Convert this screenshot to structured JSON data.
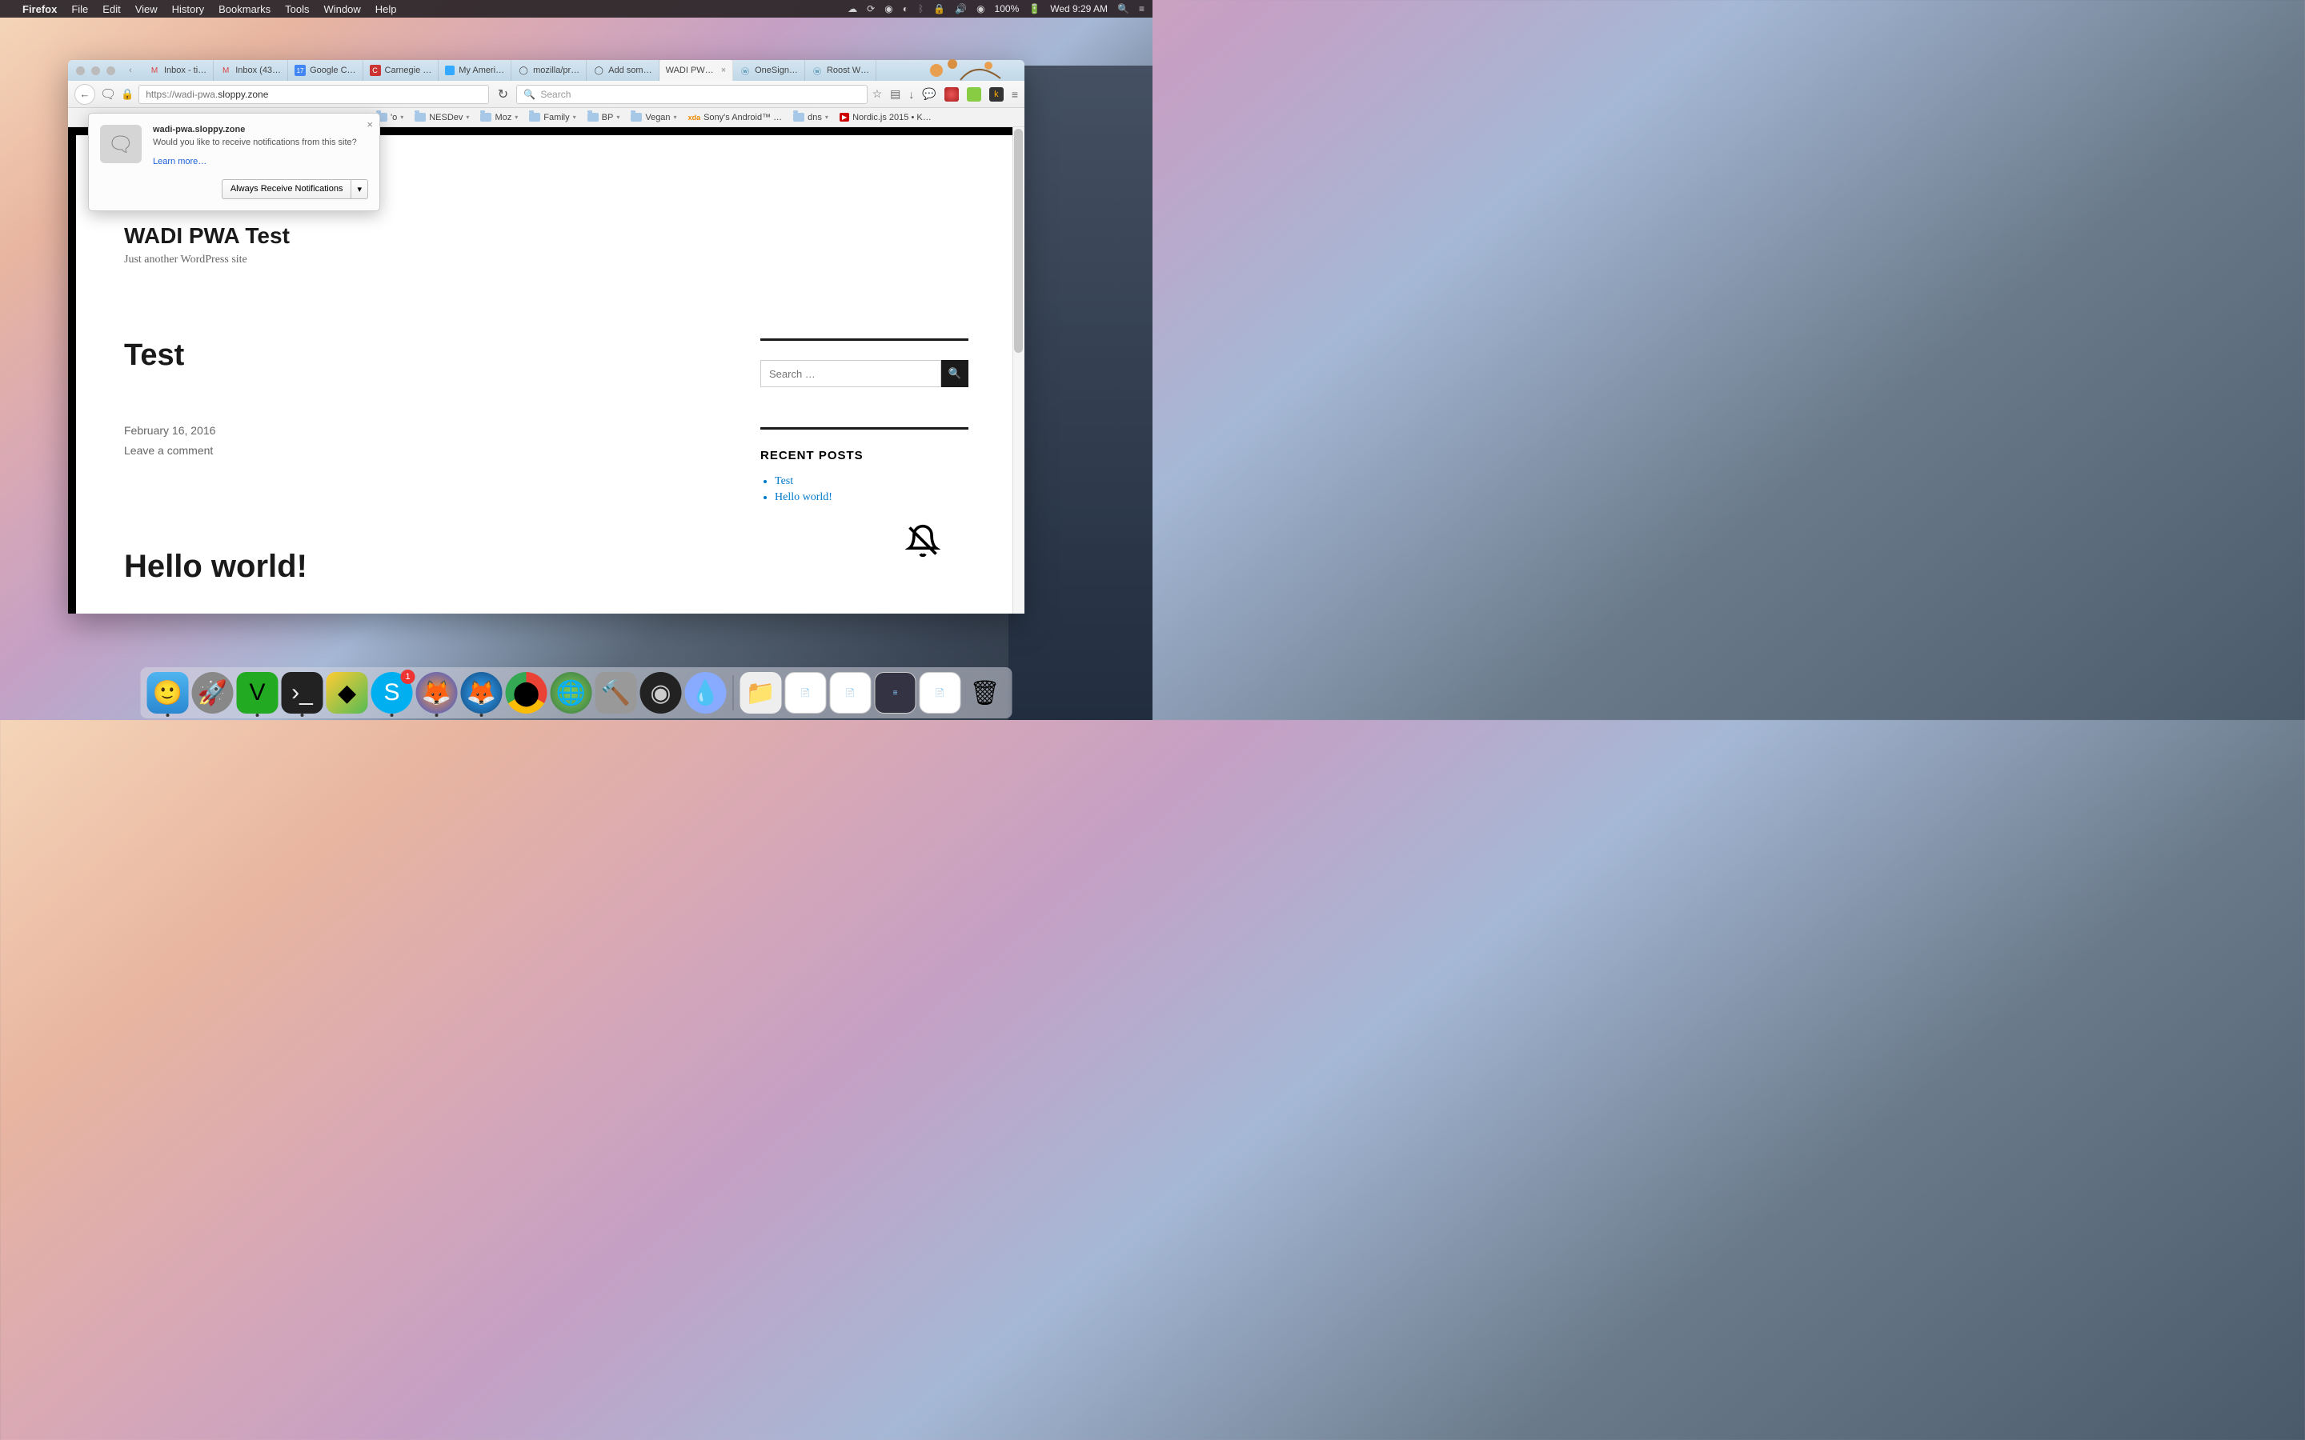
{
  "menubar": {
    "app": "Firefox",
    "items": [
      "File",
      "Edit",
      "View",
      "History",
      "Bookmarks",
      "Tools",
      "Window",
      "Help"
    ],
    "battery": "100%",
    "clock": "Wed 9:29 AM"
  },
  "tabs": [
    {
      "label": "Inbox - ti…",
      "icon": "gmail"
    },
    {
      "label": "Inbox (43…",
      "icon": "gmail"
    },
    {
      "label": "Google C…",
      "icon": "gcal"
    },
    {
      "label": "Carnegie …",
      "icon": "c-red"
    },
    {
      "label": "My Ameri…",
      "icon": "blue-sq"
    },
    {
      "label": "mozilla/pr…",
      "icon": "github"
    },
    {
      "label": "Add som…",
      "icon": "github"
    },
    {
      "label": "WADI PW…",
      "icon": "",
      "active": true
    },
    {
      "label": "OneSign…",
      "icon": "wp"
    },
    {
      "label": "Roost W…",
      "icon": "wp"
    }
  ],
  "url": {
    "prefix": "https://wadi-pwa.",
    "domain": "sloppy.zone"
  },
  "search_placeholder": "Search",
  "bookmarks": [
    {
      "label": "'o",
      "type": "folder"
    },
    {
      "label": "NESDev",
      "type": "folder"
    },
    {
      "label": "Moz",
      "type": "folder"
    },
    {
      "label": "Family",
      "type": "folder"
    },
    {
      "label": "BP",
      "type": "folder"
    },
    {
      "label": "Vegan",
      "type": "folder"
    },
    {
      "label": "Sony's Android™ …",
      "type": "xda"
    },
    {
      "label": "dns",
      "type": "folder"
    },
    {
      "label": "Nordic.js 2015 • K…",
      "type": "yt"
    }
  ],
  "notification": {
    "domain": "wadi-pwa.sloppy.zone",
    "message": "Would you like to receive notifications from this site?",
    "learn": "Learn more…",
    "button": "Always Receive Notifications"
  },
  "site": {
    "title": "WADI PWA Test",
    "tagline": "Just another WordPress site",
    "posts": [
      {
        "title": "Test",
        "date": "February 16, 2016",
        "comment": "Leave a comment"
      },
      {
        "title": "Hello world!"
      }
    ],
    "search_placeholder": "Search …",
    "recent_heading": "RECENT POSTS",
    "recent": [
      "Test",
      "Hello world!"
    ]
  },
  "dock": {
    "skype_badge": "1"
  }
}
